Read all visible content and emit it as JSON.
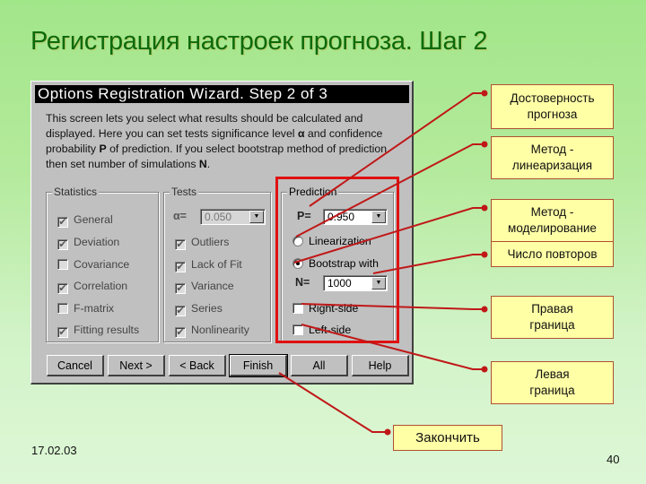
{
  "slide": {
    "title": "Регистрация настроек прогноза. Шаг 2",
    "date": "17.02.03",
    "page_number": "40"
  },
  "dialog": {
    "title": "Options Registration Wizard. Step 2 of 3",
    "description": {
      "part1": "This screen lets you select what results should be calculated and displayed. Here you can set tests significance level ",
      "alpha": "α",
      "part2": " and confidence probability ",
      "p": "P",
      "part3": " of prediction. If you select bootstrap method of prediction then set number of simulations ",
      "n": "N",
      "part4": "."
    },
    "statistics": {
      "label": "Statistics",
      "items": [
        {
          "label": "General",
          "checked": true
        },
        {
          "label": "Deviation",
          "checked": true
        },
        {
          "label": "Covariance",
          "checked": false
        },
        {
          "label": "Correlation",
          "checked": true
        },
        {
          "label": "F-matrix",
          "checked": false
        },
        {
          "label": "Fitting results",
          "checked": true
        }
      ]
    },
    "tests": {
      "label": "Tests",
      "alpha_label": "α=",
      "alpha_value": "0.050",
      "items": [
        {
          "label": "Outliers",
          "checked": true
        },
        {
          "label": "Lack of Fit",
          "checked": true
        },
        {
          "label": "Variance",
          "checked": true
        },
        {
          "label": "Series",
          "checked": true
        },
        {
          "label": "Nonlinearity",
          "checked": true
        }
      ]
    },
    "prediction": {
      "label": "Prediction",
      "p_label": "P=",
      "p_value": "0.950",
      "method_options": [
        {
          "label": "Linearization",
          "selected": false
        },
        {
          "label": "Bootstrap with",
          "selected": true
        }
      ],
      "n_label": "N=",
      "n_value": "1000",
      "bounds": [
        {
          "label": "Right-side",
          "checked": false
        },
        {
          "label": "Left-side",
          "checked": false
        }
      ]
    },
    "buttons": {
      "cancel": "Cancel",
      "next": "Next >",
      "back": "< Back",
      "finish": "Finish",
      "all": "All",
      "help": "Help"
    }
  },
  "callouts": {
    "reliability": {
      "line1": "Достоверность",
      "line2": "прогноза"
    },
    "linearization": {
      "line1": "Метод -",
      "line2": "линеаризация"
    },
    "modeling": {
      "line1": "Метод -",
      "line2": "моделирование"
    },
    "repetitions": "Число повторов",
    "right_bound": {
      "line1": "Правая",
      "line2": "граница"
    },
    "left_bound": {
      "line1": "Левая",
      "line2": "граница"
    },
    "finish": "Закончить"
  },
  "colors": {
    "title_green": "#0c6a0c",
    "callout_fill": "#ffffa6",
    "callout_line": "#c01818",
    "highlight_red": "#e01010",
    "dialog_gray": "#c0c0c0"
  }
}
